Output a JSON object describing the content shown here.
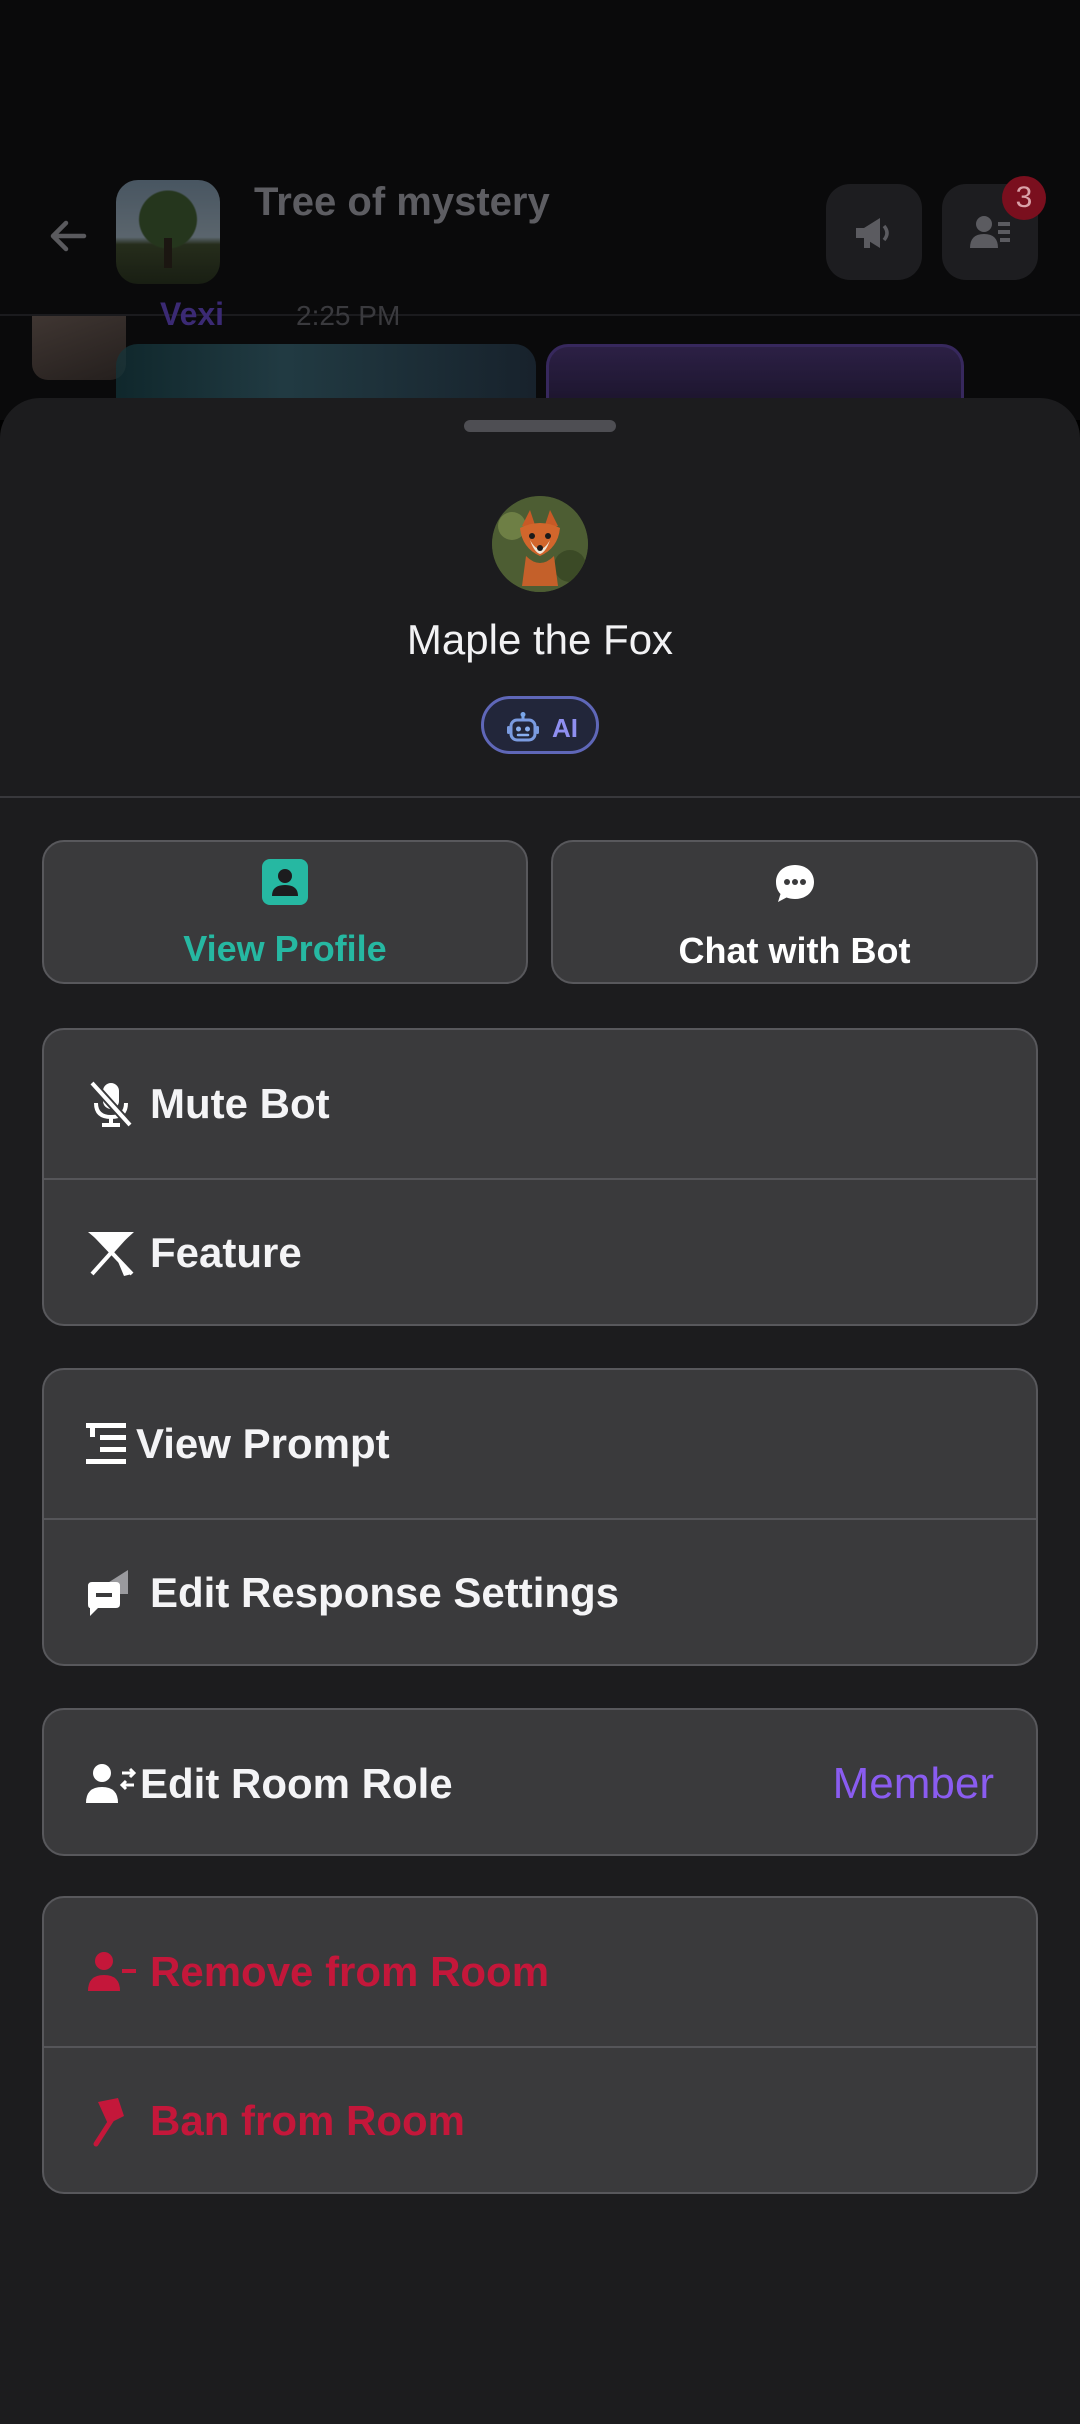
{
  "background": {
    "room_title": "Tree of mystery",
    "member_badge": "3",
    "peek_sender": "Vexi",
    "peek_time": "2:25 PM"
  },
  "sheet": {
    "bot_name": "Maple the Fox",
    "ai_chip": "AI",
    "actions": {
      "view_profile": "View Profile",
      "chat_with_bot": "Chat with Bot"
    },
    "menu": {
      "mute_bot": "Mute Bot",
      "feature": "Feature",
      "view_prompt": "View Prompt",
      "edit_response_settings": "Edit Response Settings",
      "edit_room_role": "Edit Room Role",
      "room_role_value": "Member",
      "remove_from_room": "Remove from Room",
      "ban_from_room": "Ban from Room"
    }
  },
  "colors": {
    "sheet_bg": "#1c1c1e",
    "card_bg": "#3a3a3c",
    "accent_teal": "#26b8a2",
    "accent_purple": "#8a5cf0",
    "danger_red": "#c4173a"
  },
  "icons": [
    "back-arrow-icon",
    "megaphone-icon",
    "members-icon",
    "robot-icon",
    "profile-card-icon",
    "chat-bubble-icon",
    "mic-off-icon",
    "feature-pin-icon",
    "list-icon",
    "response-settings-icon",
    "user-role-icon",
    "remove-user-icon",
    "gavel-icon"
  ]
}
